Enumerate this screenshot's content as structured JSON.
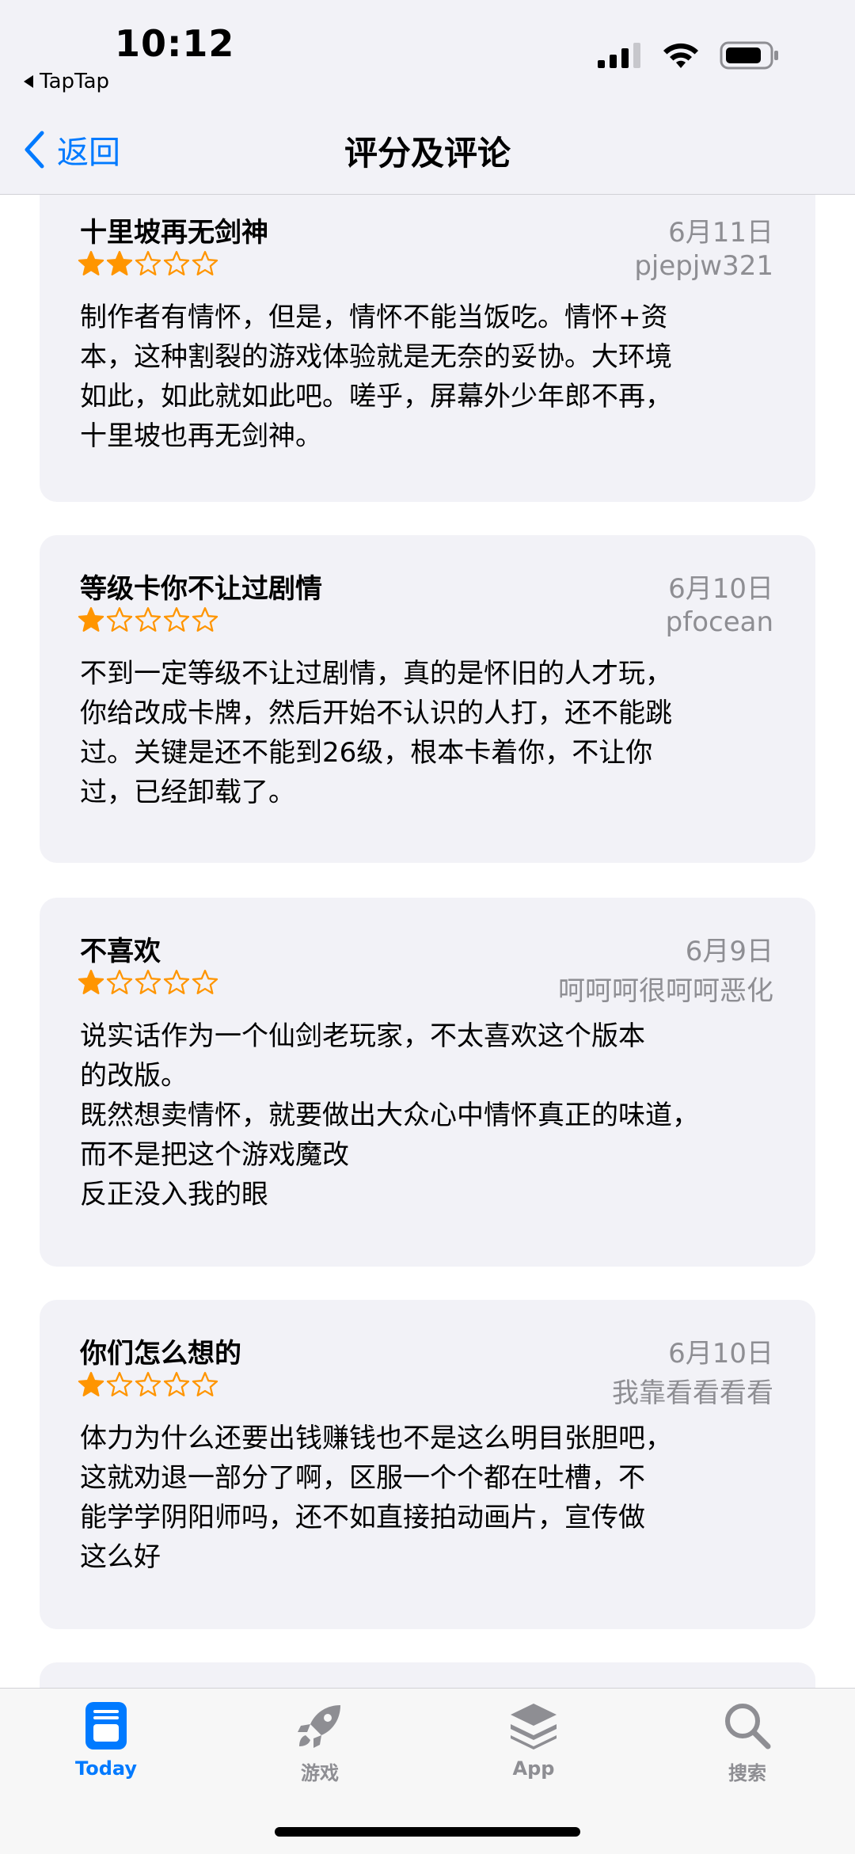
{
  "status": {
    "time": "10:12",
    "back_app": "TapTap"
  },
  "nav": {
    "back_label": "返回",
    "title": "评分及评论"
  },
  "colors": {
    "accent": "#007aff",
    "star": "#ff9500",
    "card_bg": "#f2f2f7",
    "secondary_text": "#8e8e93"
  },
  "reviews": [
    {
      "title": "十里坡再无剑神",
      "date": "6月11日",
      "author": "pjepjw321",
      "rating": 2,
      "body": "制作者有情怀，但是，情怀不能当饭吃。情怀+资\n本，这种割裂的游戏体验就是无奈的妥协。大环境\n如此，如此就如此吧。嗟乎，屏幕外少年郎不再，\n十里坡也再无剑神。"
    },
    {
      "title": "等级卡你不让过剧情",
      "date": "6月10日",
      "author": "pfocean",
      "rating": 1,
      "body": "不到一定等级不让过剧情，真的是怀旧的人才玩，\n你给改成卡牌，然后开始不认识的人打，还不能跳\n过。关键是还不能到26级，根本卡着你，不让你\n过，已经卸载了。"
    },
    {
      "title": "不喜欢",
      "date": "6月9日",
      "author": "呵呵呵很呵呵恶化",
      "rating": 1,
      "body": "说实话作为一个仙剑老玩家，不太喜欢这个版本\n的改版。\n既然想卖情怀，就要做出大众心中情怀真正的味道，\n而不是把这个游戏魔改\n反正没入我的眼"
    },
    {
      "title": "你们怎么想的",
      "date": "6月10日",
      "author": "我靠看看看看",
      "rating": 1,
      "body": "体力为什么还要出钱赚钱也不是这么明目张胆吧，\n这就劝退一部分了啊，区服一个个都在吐槽，不\n能学学阴阳师吗，还不如直接拍动画片，宣传做\n这么好"
    }
  ],
  "tabbar": {
    "items": [
      {
        "label": "Today",
        "icon": "today-icon",
        "active": true
      },
      {
        "label": "游戏",
        "icon": "rocket-icon",
        "active": false
      },
      {
        "label": "App",
        "icon": "stack-icon",
        "active": false
      },
      {
        "label": "搜索",
        "icon": "search-icon",
        "active": false
      }
    ]
  }
}
